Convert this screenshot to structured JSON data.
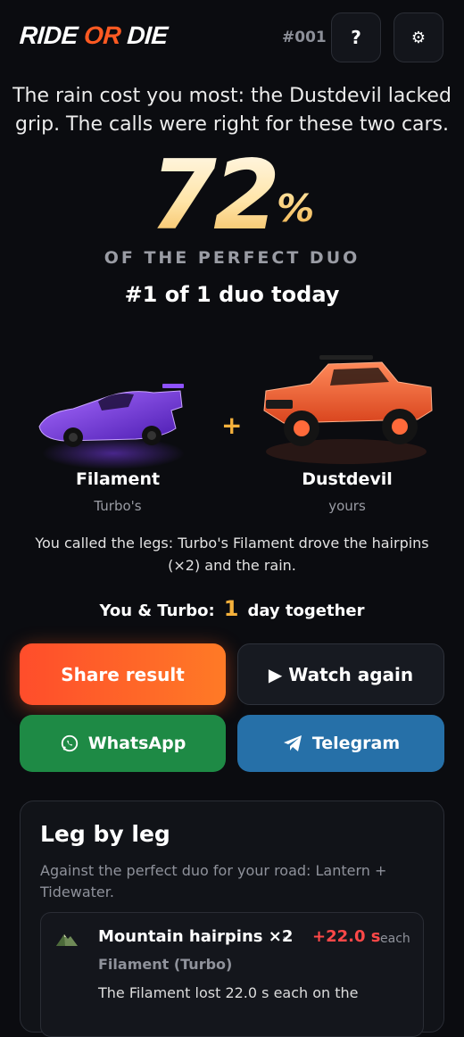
{
  "header": {
    "logo": {
      "part1": "RIDE ",
      "part2": "OR",
      "part3": " DIE"
    },
    "round_number": "#001",
    "help_label": "?",
    "settings_label": "⚙"
  },
  "result": {
    "summary": "The rain cost you most: the Dustdevil lacked grip. The calls were right for these two cars.",
    "percent_value": "72",
    "percent_sign": "%",
    "percent_caption": "OF THE PERFECT DUO",
    "rank_text": "#1 of 1 duo today"
  },
  "duo": {
    "left_car": {
      "name": "Filament",
      "owner": "Turbo's",
      "color": "#7b3cf0"
    },
    "plus": "+",
    "right_car": {
      "name": "Dustdevil",
      "owner": "yours",
      "color": "#ff6a3a"
    }
  },
  "legs_called": "You called the legs: Turbo's Filament drove the hairpins (×2) and the rain.",
  "together": {
    "prefix": "You & Turbo:",
    "days": "1",
    "suffix": "day together"
  },
  "buttons": {
    "share": "Share result",
    "watch": "▶ Watch again",
    "whatsapp": "WhatsApp",
    "telegram": "Telegram"
  },
  "leg_by_leg": {
    "title": "Leg by leg",
    "subtitle": "Against the perfect duo for your road: Lantern + Tidewater.",
    "legs": [
      {
        "icon": "mountain-icon",
        "title": "Mountain hairpins ×2",
        "separator": "·",
        "delta": "+22.0 s",
        "delta_unit": "each",
        "car": "Filament (Turbo)",
        "description": "The Filament lost 22.0 s each on the"
      }
    ]
  },
  "colors": {
    "accent": "#ff5a22",
    "gold": "#f5b13c",
    "negative": "#ff4848",
    "whatsapp": "#1e8a45",
    "telegram": "#2670a8",
    "background": "#0b0c10"
  }
}
